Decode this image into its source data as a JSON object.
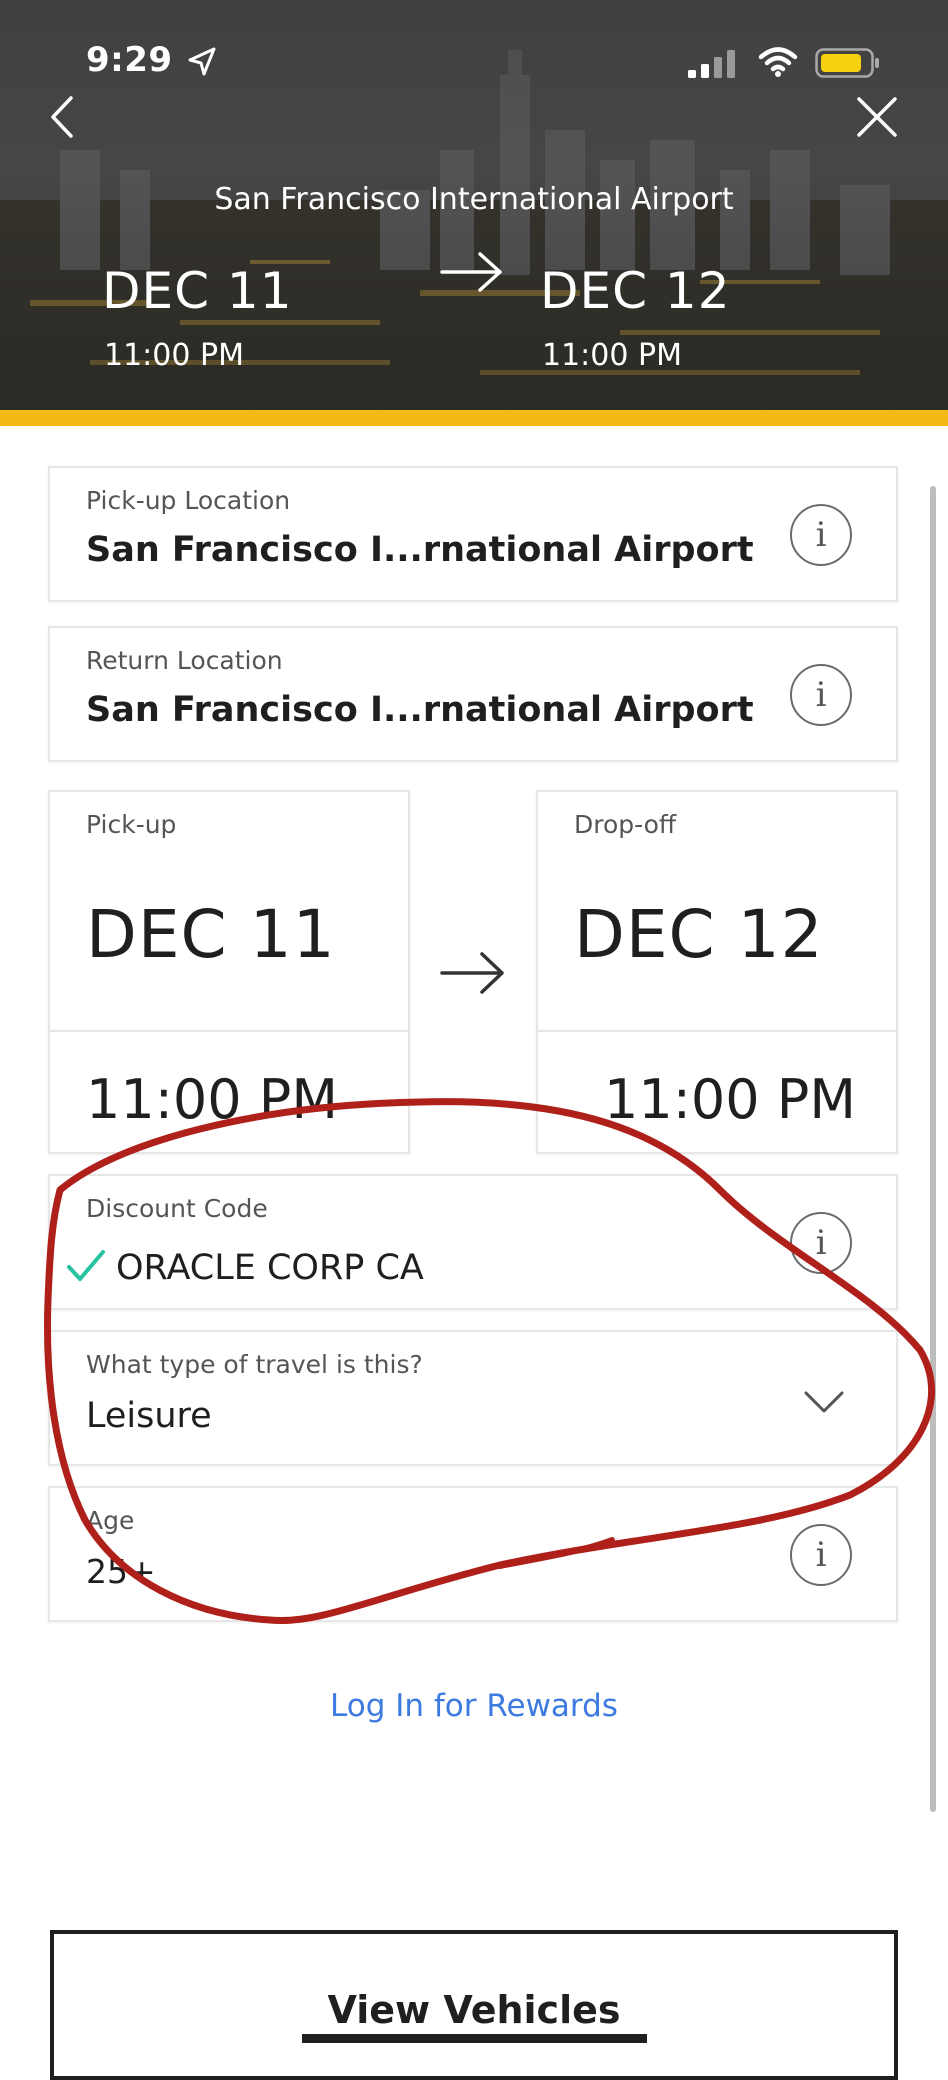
{
  "status_bar": {
    "time": "9:29"
  },
  "header": {
    "location": "San Francisco International Airport",
    "pickup_date": "DEC 11",
    "pickup_time": "11:00 PM",
    "return_date": "DEC 12",
    "return_time": "11:00 PM"
  },
  "form": {
    "pickup_location": {
      "label": "Pick-up Location",
      "value": "San Francisco I...rnational Airport"
    },
    "return_location": {
      "label": "Return Location",
      "value": "San Francisco I...rnational Airport"
    },
    "pickup": {
      "label": "Pick-up",
      "date": "DEC 11",
      "time": "11:00 PM"
    },
    "dropoff": {
      "label": "Drop-off",
      "date": "DEC 12",
      "time": "11:00 PM"
    },
    "discount": {
      "label": "Discount Code",
      "value": "ORACLE CORP CA"
    },
    "travel_type": {
      "label": "What type of travel is this?",
      "value": "Leisure"
    },
    "age": {
      "label": "Age",
      "value": "25+"
    }
  },
  "links": {
    "rewards": "Log In for Rewards"
  },
  "buttons": {
    "view_vehicles": "View Vehicles"
  },
  "colors": {
    "accent": "#f5b915",
    "link": "#3d7be0",
    "check": "#27c2a0",
    "annotation": "#b0201a"
  },
  "icons": [
    "location-arrow-icon",
    "signal-icon",
    "wifi-icon",
    "battery-icon",
    "back-chevron-icon",
    "close-icon",
    "arrow-right-icon",
    "info-icon",
    "check-icon",
    "chevron-down-icon"
  ]
}
